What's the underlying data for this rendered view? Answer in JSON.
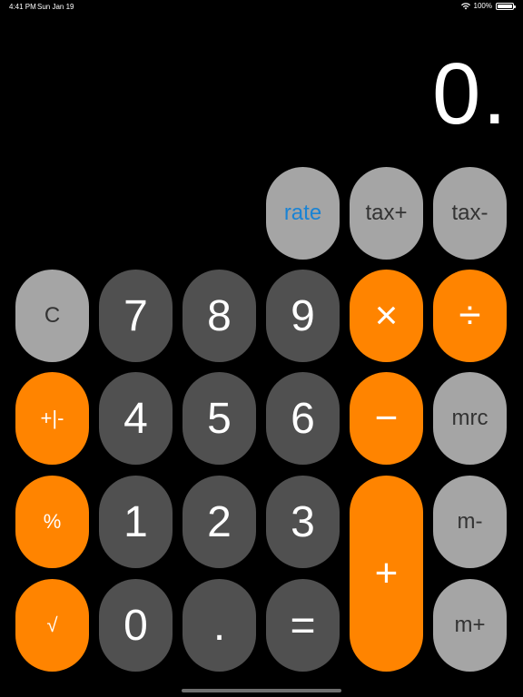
{
  "status_bar": {
    "time": "4:41 PM",
    "date": "Sun Jan 19",
    "battery": "100%",
    "icons": [
      "wifi-icon",
      "battery-icon"
    ]
  },
  "display": {
    "value": "0."
  },
  "keys": {
    "rate": "rate",
    "tax_plus": "tax+",
    "tax_minus": "tax-",
    "clear": "C",
    "seven": "7",
    "eight": "8",
    "nine": "9",
    "multiply": "×",
    "divide": "÷",
    "plus_minus": "+|-",
    "four": "4",
    "five": "5",
    "six": "6",
    "minus": "−",
    "mrc": "mrc",
    "percent": "%",
    "one": "1",
    "two": "2",
    "three": "3",
    "plus": "+",
    "m_minus": "m-",
    "sqrt": "√",
    "zero": "0",
    "decimal": ".",
    "equals": "=",
    "m_plus": "m+"
  },
  "colors": {
    "background": "#000000",
    "dark_key": "#505050",
    "light_key": "#a5a5a5",
    "orange_key": "#ff8400",
    "rate_text": "#1a83d4"
  }
}
